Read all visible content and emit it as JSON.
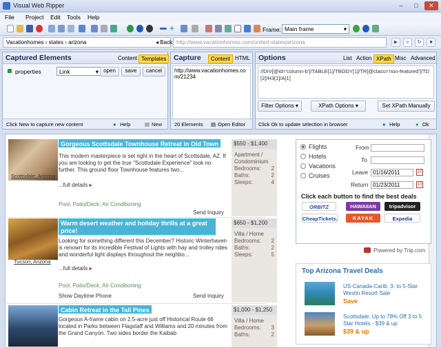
{
  "window": {
    "title": "Visual Web Ripper"
  },
  "menu": [
    "File",
    "Project",
    "Edit",
    "Tools",
    "Help"
  ],
  "toolbar": {
    "frame_label": "Frame:",
    "frame_value": "Main frame"
  },
  "nav": {
    "breadcrumb": "Vacationhomes  ›  states  ›  arizona",
    "back": "Back",
    "url": "http://www.vacationhomes.com/united-states/arizona"
  },
  "captured": {
    "title": "Captured Elements",
    "tabs": [
      "Content",
      "Templates"
    ],
    "row_name": "properties",
    "row_type": "Link",
    "buttons": [
      "open",
      "save",
      "cancel"
    ],
    "footer_text": "Click New to capture new content",
    "help": "Help",
    "new": "New"
  },
  "capture": {
    "title": "Capture",
    "tabs": [
      "Content",
      "HTML"
    ],
    "text": "http://www.vacationhomes.com/21234",
    "footer_count": "20 Elements",
    "footer_open": "Open Editor"
  },
  "options": {
    "title": "Options",
    "tabs": [
      "List",
      "Action",
      "XPath",
      "Misc",
      "Advanced"
    ],
    "xpath": "//DIV[@id='column-b']/TABLE[1]/TBODY[1]/TR[@class='non-featured']/TD[2]/H3[1]/A[1]",
    "buttons": [
      "Filter Options",
      "XPath Options",
      "Set XPath Manually"
    ],
    "footer_text": "Click Ok to update selection in browser",
    "help": "Help",
    "ok": "Ok"
  },
  "listings": [
    {
      "title": "Gorgeous Scottsdale Townhouse Retreat in Old Town",
      "location": "Scottsdale, Arizona",
      "desc": "This modern masterpiece is set right in the heart of Scottsdale, AZ. If you are looking to get the true \"Scottsdale Experience\" look no further. This ground floor Townhouse features two...",
      "full": "...full details",
      "amenities": "Pool, Patio/Deck, Air Conditioning",
      "extra": "",
      "send": "Send Inquiry",
      "price": "$550 - $1,400",
      "type": "Apartment / Condominium",
      "bedrooms": "2",
      "baths": "2",
      "sleeps": "4"
    },
    {
      "title": "Warm desert weather and holiday thrills at a great price!",
      "location": "Tucson, Arizona",
      "desc": "Looking for something different this December? Historic Winterhaven is renown for its incredible Festival of Lights with hay and trolley rides and wonderful light displays throughout the neighbo...",
      "full": "...full details",
      "amenities": "Pool, Patio/Deck, Air Conditioning",
      "extra": "Show Daytime Phone",
      "send": "Send Inquiry",
      "price": "$650 - $1,200",
      "type": "Villa / Home",
      "bedrooms": "2",
      "baths": "2",
      "sleeps": "5"
    },
    {
      "title": "Cabin Retreat in the Tall Pines",
      "location": "",
      "desc": "Gorgeous A-frame cabin on 2.5-acre just off Historical Route 66 located in Parks between Flagstaff and Williams and 20 minutes from the Grand Canyon. Two sides border the Kaibab",
      "full": "",
      "amenities": "",
      "extra": "",
      "send": "",
      "price": "$1,000 - $1,250",
      "type": "Villa / Home",
      "bedrooms": "3",
      "baths": "2",
      "sleeps": ""
    }
  ],
  "labels": {
    "bedrooms": "Bedrooms:",
    "baths": "Baths:",
    "sleeps": "Sleeps:"
  },
  "trip": {
    "options": [
      "Flights",
      "Hotels",
      "Vacations",
      "Cruises"
    ],
    "from": "From",
    "to": "To",
    "leave": "Leave",
    "leave_date": "01/16/2011",
    "return": "Return",
    "return_date": "01/23/2011",
    "cta": "Click each button to find the best deals",
    "powered": "Powered by Trip.com",
    "partners": [
      "ORBITZ",
      "HAWAIIAN",
      "tripadvisor",
      "CheapTickets.",
      "KAYAK",
      "Expedia"
    ]
  },
  "deals": {
    "title": "Top Arizona Travel Deals",
    "items": [
      {
        "text": "US-Canada-Carib: 3- to 5-Star Westin Resort Sale",
        "sub": "Save"
      },
      {
        "text": "Scottsdale: Up to 78% Off 3 to 5 Star Hotels - $39 & up",
        "sub": "$39 & up"
      }
    ]
  }
}
